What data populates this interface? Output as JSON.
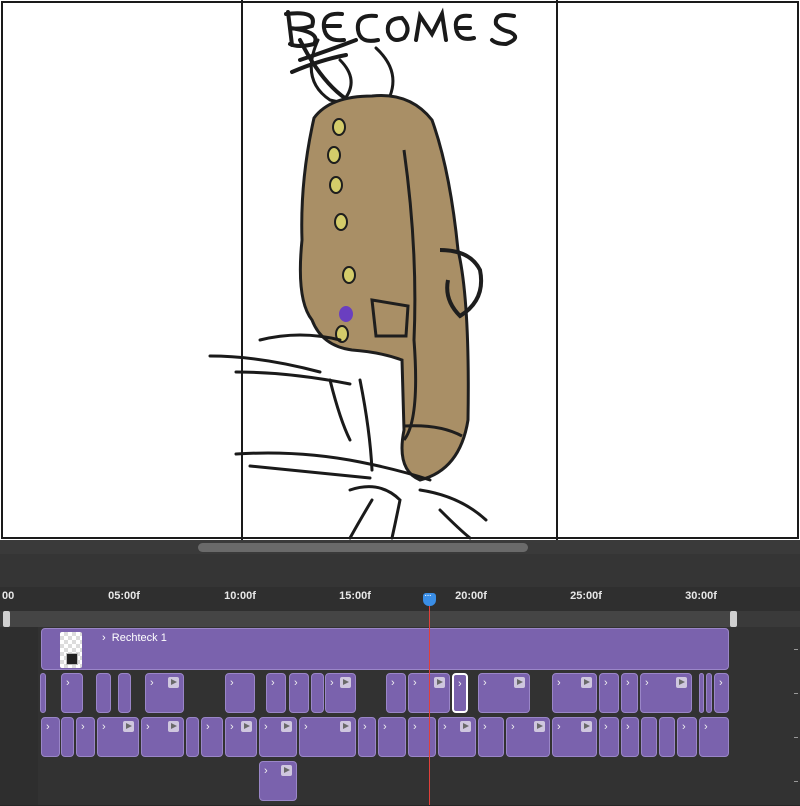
{
  "canvas": {
    "title_text": "BECOMES",
    "colors": {
      "coat": "#a98f66",
      "button": "#d4cc6a",
      "accent": "#6a3fc0",
      "ink": "#1e1e1e"
    }
  },
  "timeline": {
    "ruler_labels": [
      "00",
      "05:00f",
      "10:00f",
      "15:00f",
      "20:00f",
      "25:00f",
      "30:00f"
    ],
    "main_layer": {
      "label": "Rechteck 1"
    },
    "colors": {
      "clip": "#7a62ad",
      "playhead": "#e0403a",
      "playhead_head": "#3a8ee6"
    }
  }
}
